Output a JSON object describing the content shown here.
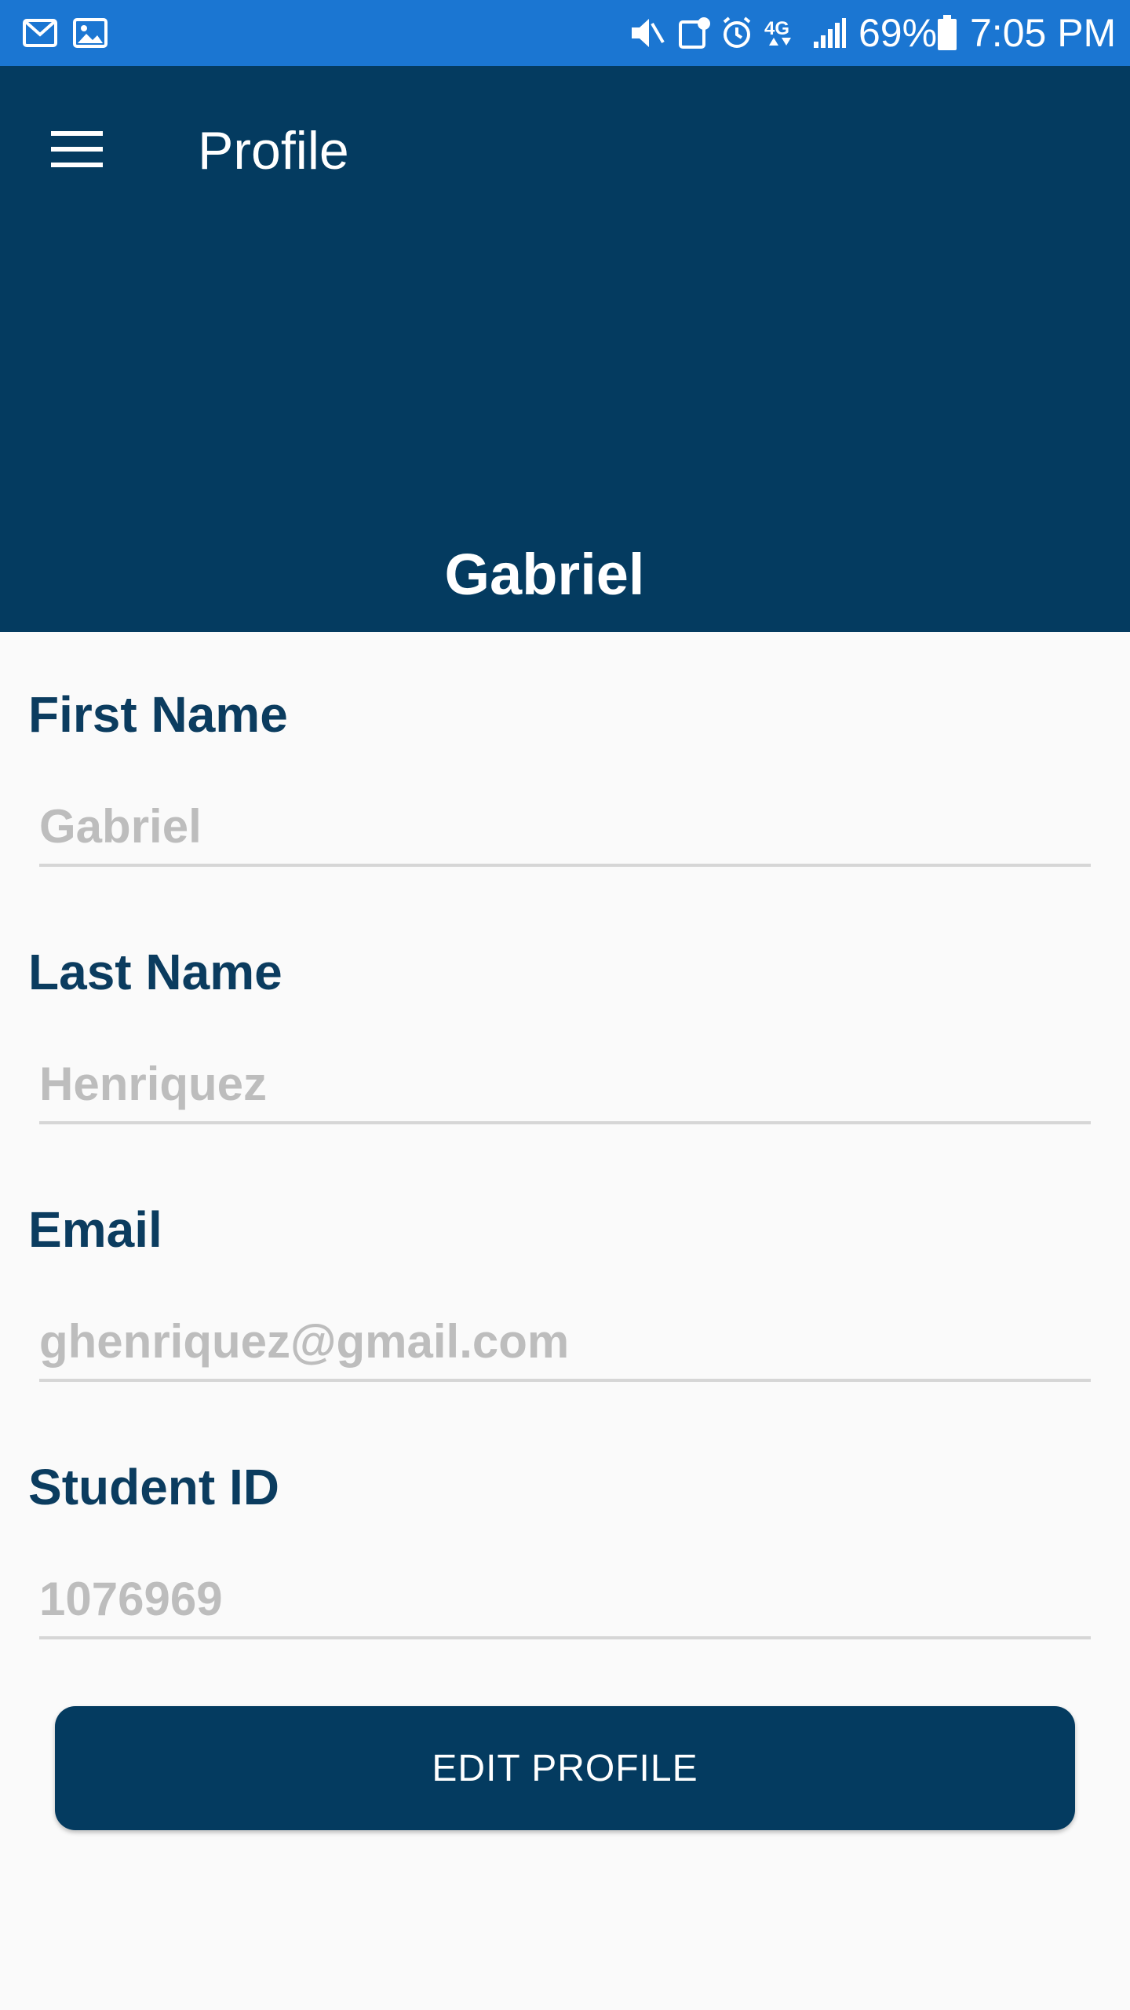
{
  "status_bar": {
    "icons": [
      "gmail-icon",
      "gallery-icon",
      "mute-icon",
      "data-saver-icon",
      "alarm-icon",
      "4g-lte-icon",
      "signal-icon"
    ],
    "battery_percent": "69%",
    "time": "7:05 PM",
    "background_color": "#1b76d2"
  },
  "app_bar": {
    "title": "Profile",
    "menu_icon": "hamburger-menu-icon",
    "profile_name": "Gabriel",
    "background_color": "#043b60"
  },
  "form": {
    "first_name": {
      "label": "First Name",
      "placeholder": "Gabriel"
    },
    "last_name": {
      "label": "Last Name",
      "placeholder": "Henriquez"
    },
    "email": {
      "label": "Email",
      "placeholder": "ghenriquez@gmail.com"
    },
    "student_id": {
      "label": "Student ID",
      "placeholder": "1076969"
    }
  },
  "actions": {
    "edit_profile_label": "EDIT PROFILE"
  },
  "colors": {
    "label_color": "#0b3c5f",
    "placeholder_color": "#bdbdbd",
    "page_background": "#fafafa"
  }
}
